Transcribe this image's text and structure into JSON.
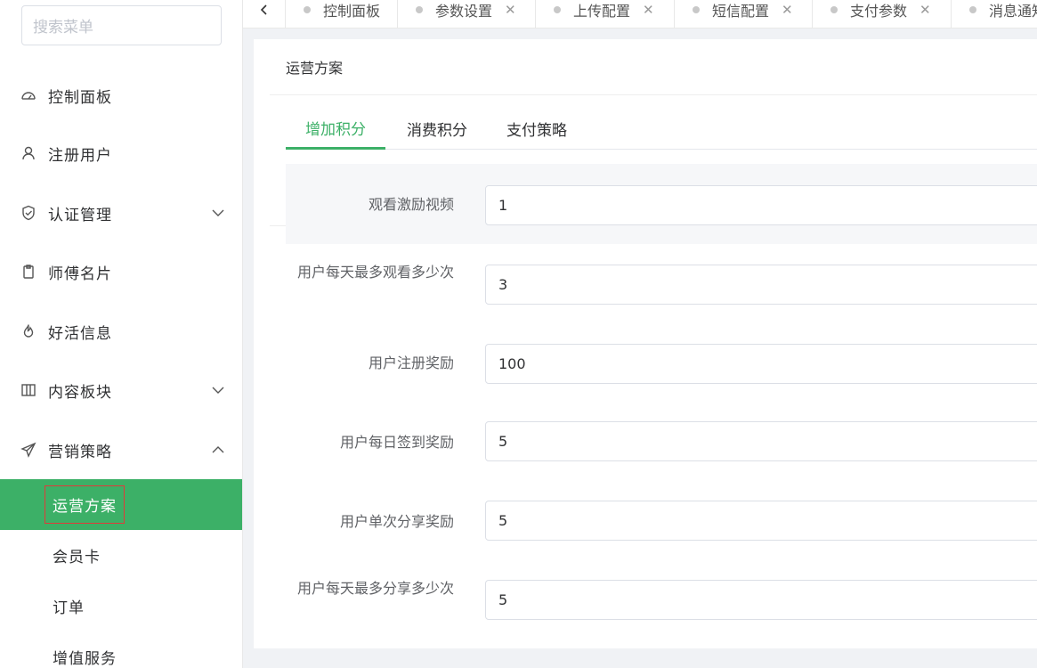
{
  "sidebar": {
    "search_placeholder": "搜索菜单",
    "items": [
      {
        "label": "控制面板",
        "icon": "dashboard-icon"
      },
      {
        "label": "注册用户",
        "icon": "user-icon"
      },
      {
        "label": "认证管理",
        "icon": "shield-icon"
      },
      {
        "label": "师傅名片",
        "icon": "clipboard-icon"
      },
      {
        "label": "好活信息",
        "icon": "flame-icon"
      },
      {
        "label": "内容板块",
        "icon": "columns-icon"
      },
      {
        "label": "营销策略",
        "icon": "send-icon"
      }
    ],
    "sub_items": [
      {
        "label": "运营方案",
        "active": true
      },
      {
        "label": "会员卡"
      },
      {
        "label": "订单"
      },
      {
        "label": "增值服务"
      }
    ]
  },
  "tabbar": {
    "tabs": [
      {
        "label": "控制面板"
      },
      {
        "label": "参数设置"
      },
      {
        "label": "上传配置"
      },
      {
        "label": "短信配置"
      },
      {
        "label": "支付参数"
      },
      {
        "label": "消息通知"
      }
    ]
  },
  "card": {
    "title": "运营方案",
    "tabs": [
      "增加积分",
      "消费积分",
      "支付策略"
    ],
    "active_tab": "增加积分",
    "fields": [
      {
        "label": "观看激励视频",
        "value": "1"
      },
      {
        "label": "用户每天最多观看多少次",
        "value": "3"
      },
      {
        "label": "用户注册奖励",
        "value": "100"
      },
      {
        "label": "用户每日签到奖励",
        "value": "5"
      },
      {
        "label": "用户单次分享奖励",
        "value": "5"
      },
      {
        "label": "用户每天最多分享多少次",
        "value": "5"
      }
    ]
  },
  "colors": {
    "accent": "#3cb067",
    "highlight_border": "#e03a3a"
  }
}
